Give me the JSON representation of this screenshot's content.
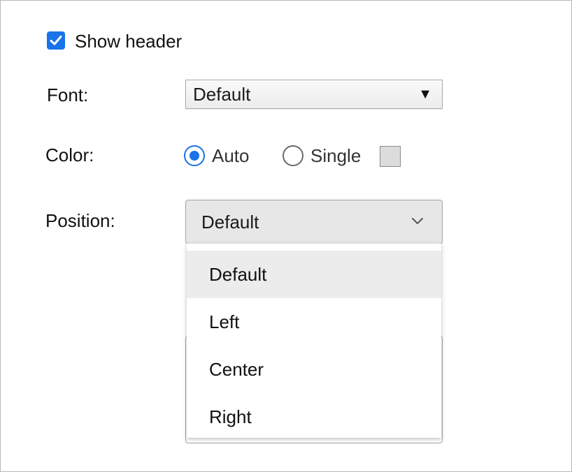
{
  "show_header": {
    "label": "Show header",
    "checked": true
  },
  "font": {
    "label": "Font:",
    "value": "Default",
    "arrow": "▼"
  },
  "color": {
    "label": "Color:",
    "options": [
      {
        "label": "Auto",
        "checked": true
      },
      {
        "label": "Single",
        "checked": false
      }
    ],
    "swatch_color": "#dcdcdc"
  },
  "position": {
    "label": "Position:",
    "value": "Default",
    "menu_items": [
      {
        "label": "Default",
        "selected": true
      },
      {
        "label": "Left",
        "selected": false
      },
      {
        "label": "Center",
        "selected": false
      },
      {
        "label": "Right",
        "selected": false
      }
    ]
  },
  "colors": {
    "accent": "#1a73e8",
    "menu_selected_bg": "#ececec",
    "select_bg": "#e7e7e7"
  }
}
